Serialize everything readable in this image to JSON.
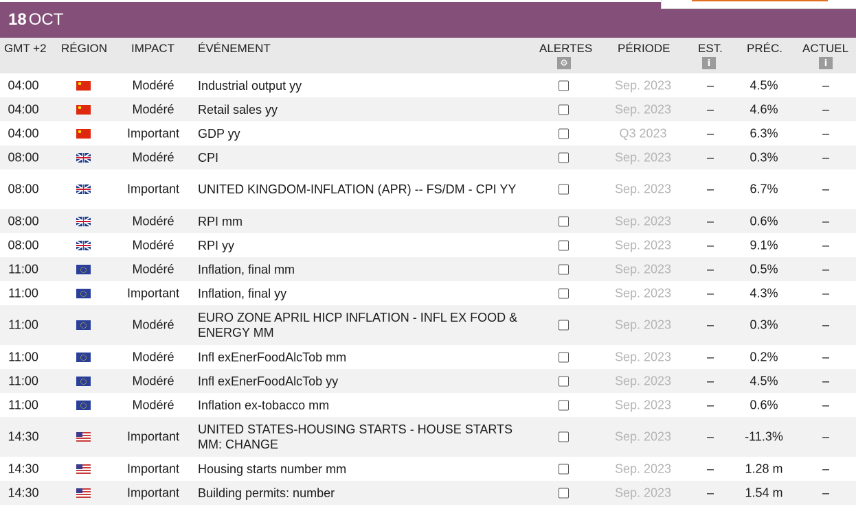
{
  "date": {
    "day": "18",
    "month": "OCT"
  },
  "columns": {
    "time": "GMT +2",
    "region": "RÉGION",
    "impact": "IMPACT",
    "event": "ÉVÉNEMENT",
    "alerts": "ALERTES",
    "period": "PÉRIODE",
    "est": "EST.",
    "prev": "PRÉC.",
    "actual": "ACTUEL"
  },
  "icons": {
    "alerts_settings": "gear-icon",
    "est_info": "info-icon",
    "actual_info": "info-icon"
  },
  "colors": {
    "date_bar": "#845079",
    "header_bg": "#e9e9e9",
    "alt_row": "#f2f2f2",
    "period_text": "#b4b4b4"
  },
  "rows": [
    {
      "time": "04:00",
      "region": "china",
      "impact": "Modéré",
      "event": "Industrial output yy",
      "alert": false,
      "period": "Sep. 2023",
      "est": "–",
      "prev": "4.5%",
      "actual": "–"
    },
    {
      "time": "04:00",
      "region": "china",
      "impact": "Modéré",
      "event": "Retail sales yy",
      "alert": false,
      "period": "Sep. 2023",
      "est": "–",
      "prev": "4.6%",
      "actual": "–"
    },
    {
      "time": "04:00",
      "region": "china",
      "impact": "Important",
      "event": "GDP yy",
      "alert": false,
      "period": "Q3 2023",
      "est": "–",
      "prev": "6.3%",
      "actual": "–"
    },
    {
      "time": "08:00",
      "region": "united-kingdom",
      "impact": "Modéré",
      "event": "CPI",
      "alert": false,
      "period": "Sep. 2023",
      "est": "–",
      "prev": "0.3%",
      "actual": "–"
    },
    {
      "time": "08:00",
      "region": "united-kingdom",
      "impact": "Important",
      "event": "UNITED KINGDOM-INFLATION (APR) -- FS/DM - CPI YY",
      "alert": false,
      "period": "Sep. 2023",
      "est": "–",
      "prev": "6.7%",
      "actual": "–"
    },
    {
      "time": "08:00",
      "region": "united-kingdom",
      "impact": "Modéré",
      "event": "RPI mm",
      "alert": false,
      "period": "Sep. 2023",
      "est": "–",
      "prev": "0.6%",
      "actual": "–"
    },
    {
      "time": "08:00",
      "region": "united-kingdom",
      "impact": "Modéré",
      "event": "RPI yy",
      "alert": false,
      "period": "Sep. 2023",
      "est": "–",
      "prev": "9.1%",
      "actual": "–"
    },
    {
      "time": "11:00",
      "region": "euro-zone",
      "impact": "Modéré",
      "event": "Inflation, final mm",
      "alert": false,
      "period": "Sep. 2023",
      "est": "–",
      "prev": "0.5%",
      "actual": "–"
    },
    {
      "time": "11:00",
      "region": "euro-zone",
      "impact": "Important",
      "event": "Inflation, final yy",
      "alert": false,
      "period": "Sep. 2023",
      "est": "–",
      "prev": "4.3%",
      "actual": "–"
    },
    {
      "time": "11:00",
      "region": "euro-zone",
      "impact": "Modéré",
      "event": "EURO ZONE APRIL HICP INFLATION - INFL EX FOOD & ENERGY MM",
      "alert": false,
      "period": "Sep. 2023",
      "est": "–",
      "prev": "0.3%",
      "actual": "–"
    },
    {
      "time": "11:00",
      "region": "euro-zone",
      "impact": "Modéré",
      "event": "Infl exEnerFoodAlcTob mm",
      "alert": false,
      "period": "Sep. 2023",
      "est": "–",
      "prev": "0.2%",
      "actual": "–"
    },
    {
      "time": "11:00",
      "region": "euro-zone",
      "impact": "Modéré",
      "event": "Infl exEnerFoodAlcTob yy",
      "alert": false,
      "period": "Sep. 2023",
      "est": "–",
      "prev": "4.5%",
      "actual": "–"
    },
    {
      "time": "11:00",
      "region": "euro-zone",
      "impact": "Modéré",
      "event": "Inflation ex-tobacco mm",
      "alert": false,
      "period": "Sep. 2023",
      "est": "–",
      "prev": "0.6%",
      "actual": "–"
    },
    {
      "time": "14:30",
      "region": "united-states",
      "impact": "Important",
      "event": "UNITED STATES-HOUSING STARTS - HOUSE STARTS MM: CHANGE",
      "alert": false,
      "period": "Sep. 2023",
      "est": "–",
      "prev": "-11.3%",
      "actual": "–"
    },
    {
      "time": "14:30",
      "region": "united-states",
      "impact": "Important",
      "event": "Housing starts number mm",
      "alert": false,
      "period": "Sep. 2023",
      "est": "–",
      "prev": "1.28 m",
      "actual": "–"
    },
    {
      "time": "14:30",
      "region": "united-states",
      "impact": "Important",
      "event": "Building permits: number",
      "alert": false,
      "period": "Sep. 2023",
      "est": "–",
      "prev": "1.54 m",
      "actual": "–"
    }
  ]
}
